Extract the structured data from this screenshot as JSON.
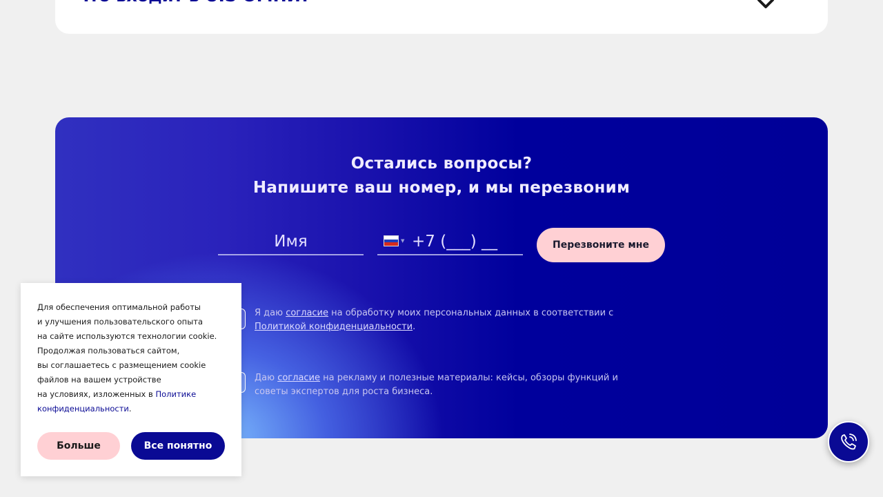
{
  "faq": {
    "question": "Что входит в UIS ОМНИ?"
  },
  "callback": {
    "title_line1": "Остались вопросы?",
    "title_line2": "Напишите ваш номер, и мы перезвоним",
    "name_placeholder": "Имя",
    "phone_placeholder": "+7 (___) __",
    "country_flag": "flag-ru-icon",
    "submit_label": "Перезвоните мне",
    "consent1": {
      "prefix": "Я даю ",
      "link": "согласие",
      "middle": " на обработку моих персональных данных в соответствии с ",
      "policy_link": "Политикой конфиденциальности",
      "suffix": "."
    },
    "consent2": {
      "prefix": "Даю ",
      "link": "согласие",
      "rest": " на рекламу и полезные материалы: кейсы, обзоры функций и советы экспертов для роста бизнеса."
    }
  },
  "cookie": {
    "lines": [
      "Для обеспечения оптимальной работы",
      "и улучшения пользовательского опыта",
      "на сайте используются технологии cookie.",
      "Продолжая пользоваться сайтом,",
      "вы соглашаетесь с размещением cookie",
      "файлов на вашем устройстве"
    ],
    "last_prefix": "на условиях, изложенных в ",
    "policy_link_1": "Политике",
    "policy_link_2": "конфиденциальности",
    "end": ".",
    "more_label": "Больше",
    "accept_label": "Все понятно"
  },
  "colors": {
    "accent": "#0a0a94",
    "pink": "#ffd0d4",
    "banner_dark": "#000098"
  },
  "icons": {
    "faq_toggle": "chevron-down-icon",
    "fab": "phone-call-icon"
  }
}
